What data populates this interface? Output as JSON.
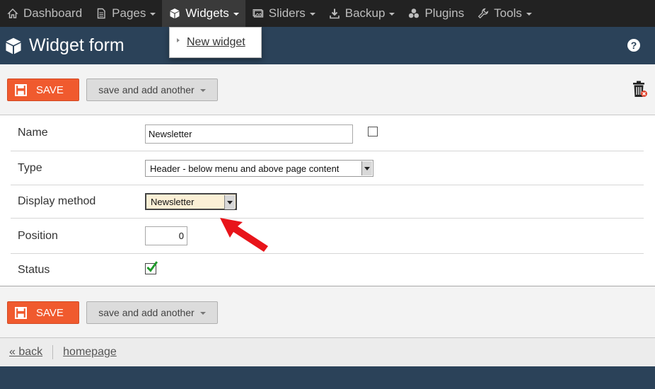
{
  "nav": {
    "items": [
      {
        "label": "Dashboard",
        "icon": "home-icon",
        "caret": false
      },
      {
        "label": "Pages",
        "icon": "document-icon",
        "caret": true
      },
      {
        "label": "Widgets",
        "icon": "cube-icon",
        "caret": true
      },
      {
        "label": "Sliders",
        "icon": "slides-icon",
        "caret": true
      },
      {
        "label": "Backup",
        "icon": "download-icon",
        "caret": true
      },
      {
        "label": "Plugins",
        "icon": "cubes-icon",
        "caret": false
      },
      {
        "label": "Tools",
        "icon": "wrench-icon",
        "caret": true
      }
    ],
    "active": "Widgets"
  },
  "dropdown": {
    "items": [
      {
        "label": "New widget"
      }
    ]
  },
  "header": {
    "title": "Widget form",
    "help_symbol": "?"
  },
  "toolbar": {
    "save_label": "SAVE",
    "another_label": "save and add another"
  },
  "form": {
    "name": {
      "label": "Name",
      "value": "Newsletter"
    },
    "type": {
      "label": "Type",
      "value": "Header - below menu and above page content"
    },
    "display_method": {
      "label": "Display method",
      "value": "Newsletter"
    },
    "position": {
      "label": "Position",
      "value": "0"
    },
    "status": {
      "label": "Status",
      "checked": true
    }
  },
  "footer": {
    "back_label": "« back",
    "homepage_label": "homepage"
  },
  "colors": {
    "accent": "#f05a2e",
    "header": "#2b4259",
    "nav": "#222222",
    "highlight_arrow": "#e8141a"
  }
}
